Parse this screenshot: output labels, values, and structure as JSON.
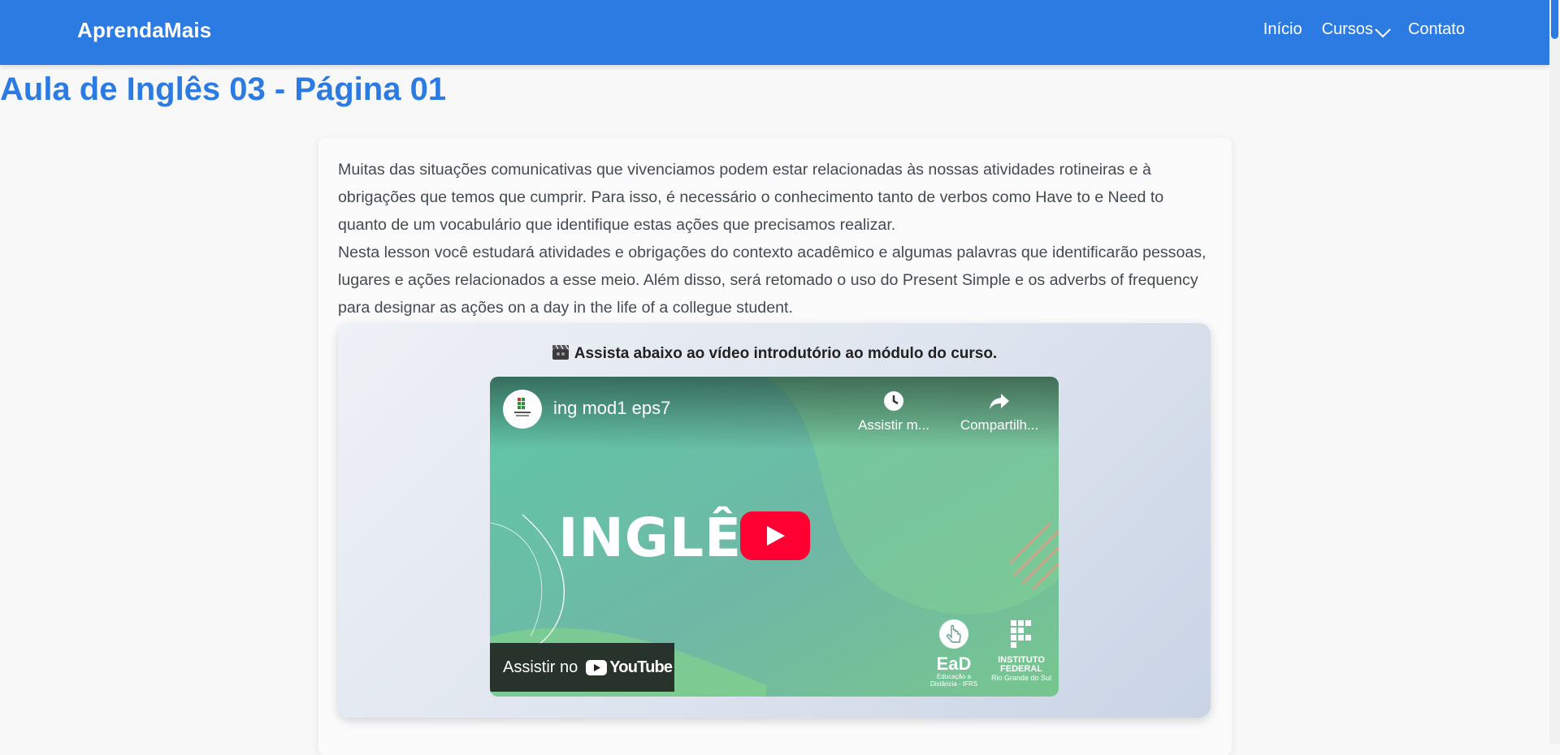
{
  "navbar": {
    "brand": "AprendaMais",
    "links": {
      "inicio": "Início",
      "cursos": "Cursos",
      "contato": "Contato"
    }
  },
  "page": {
    "title": "Aula de Inglês 03 - Página 01"
  },
  "content": {
    "paragraph_1": "Muitas das situações comunicativas que vivenciamos podem estar relacionadas às nossas atividades rotineiras e à obrigações que temos que cumprir. Para isso, é necessário o conhecimento tanto de verbos como Have to e Need to quanto de um vocabulário que identifique estas ações que precisamos realizar.",
    "paragraph_2": "Nesta lesson você estudará atividades e obrigações do contexto acadêmico e algumas palavras que identificarão pessoas, lugares e ações relacionados a esse meio. Além disso, será retomado o uso do Present Simple e os adverbs of frequency para designar as ações on a day in the life of a collegue student."
  },
  "video": {
    "caption": "Assista abaixo ao vídeo introdutório ao módulo do curso.",
    "title": "ing mod1 eps7",
    "watch_later": "Assistir m...",
    "share": "Compartilh...",
    "thumbnail_text": "INGLÊS",
    "watch_on": "Assistir no",
    "youtube": "YouTube",
    "ead_title": "EaD",
    "ead_sub": "Educação a Distância - IFRS",
    "if_title": "INSTITUTO FEDERAL",
    "if_sub": "Rio Grande do Sul"
  },
  "colors": {
    "primary": "#2b7be3",
    "youtube_red": "#ff0033",
    "thumb_green": "#6fc79b"
  }
}
